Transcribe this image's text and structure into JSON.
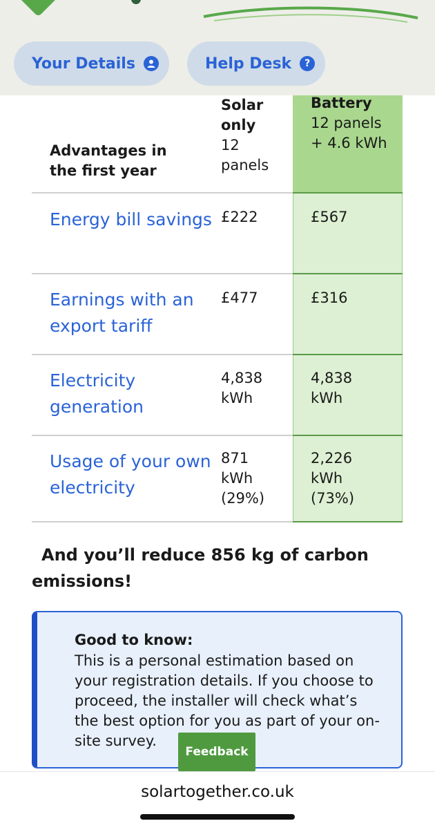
{
  "nav": {
    "your_details": "Your Details",
    "help_desk": "Help Desk",
    "help_icon_glyph": "?"
  },
  "table": {
    "header_label": "Advantages in the first year",
    "solar": {
      "title": "Solar only",
      "subtitle": "12 panels"
    },
    "battery": {
      "title": "Battery",
      "subtitle": "12 panels + 4.6 kWh"
    },
    "rows": [
      {
        "label": "Energy bill savings",
        "solar": "£222",
        "battery": "£567"
      },
      {
        "label": "Earnings with an export tariff",
        "solar": "£477",
        "battery": "£316"
      },
      {
        "label": "Electricity generation",
        "solar": "4,838 kWh",
        "battery": "4,838 kWh"
      },
      {
        "label": "Usage of your own electricity",
        "solar": "871 kWh (29%)",
        "battery": "2,226 kWh (73%)"
      }
    ]
  },
  "carbon_message": "And you’ll reduce 856 kg of carbon emissions!",
  "info_box": {
    "title": "Good to know:",
    "body": "This is a personal estimation based on your registration details. If you choose to proceed, the installer will check what’s the best option for you as part of your on-site survey."
  },
  "feedback_label": "Feedback",
  "url": "solartogether.co.uk",
  "colors": {
    "accent_blue": "#2a63d6",
    "battery_col": "#ddf0d3",
    "battery_head": "#a9d78e",
    "feedback_green": "#4f9a3f"
  }
}
